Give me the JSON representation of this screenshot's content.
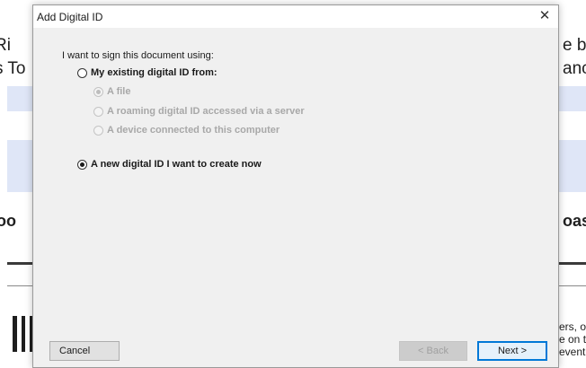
{
  "background_document": {
    "left_fragments": [
      "Ri",
      "s To",
      "oo"
    ],
    "right_fragments": [
      "e bo",
      "ance",
      "oas"
    ],
    "footer_fragments": [
      "ers, o",
      "e on th",
      "event"
    ]
  },
  "dialog": {
    "title": "Add Digital ID",
    "close_glyph": "✕",
    "prompt": "I want to sign this document using:",
    "options": {
      "existing": {
        "label": "My existing digital ID from:",
        "selected": false
      },
      "file": {
        "label": "A file",
        "selected": true,
        "enabled": false
      },
      "roaming": {
        "label": "A roaming digital ID accessed via a server",
        "selected": false,
        "enabled": false
      },
      "device": {
        "label": "A device connected to this computer",
        "selected": false,
        "enabled": false
      },
      "new_id": {
        "label": "A new digital ID I want to create now",
        "selected": true
      }
    },
    "buttons": {
      "cancel": "Cancel",
      "back": "< Back",
      "next": "Next >"
    }
  },
  "colors": {
    "dialog_bg": "#f0f0f0",
    "background_band": "#dfe6f7",
    "primary_border": "#0078d7"
  }
}
